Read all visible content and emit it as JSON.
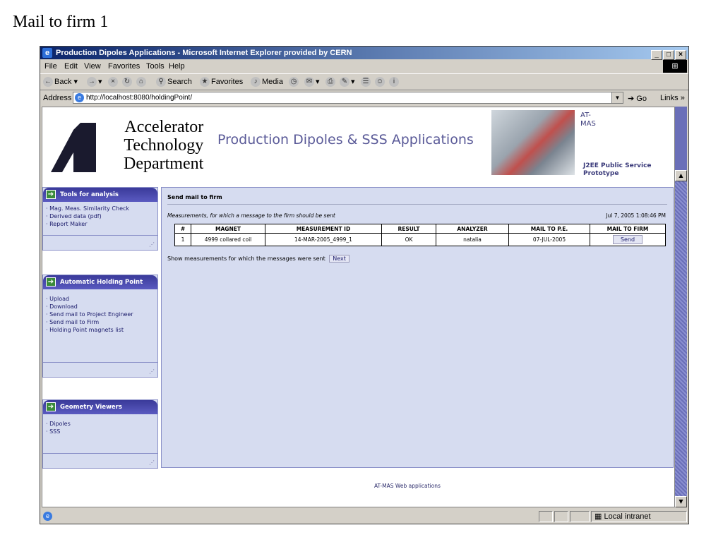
{
  "slide": {
    "title": "Mail to firm 1"
  },
  "browser": {
    "window_title": "Production Dipoles Applications - Microsoft Internet Explorer provided by CERN",
    "menu": [
      "File",
      "Edit",
      "View",
      "Favorites",
      "Tools",
      "Help"
    ],
    "toolbar": {
      "back": "Back",
      "search": "Search",
      "favorites": "Favorites",
      "media": "Media"
    },
    "address_label": "Address",
    "address_value": "http://localhost:8080/holdingPoint/",
    "go_label": "Go",
    "links_label": "Links",
    "status_zone": "Local intranet"
  },
  "page": {
    "logo_lines": [
      "Accelerator",
      "Technology",
      "Department"
    ],
    "app_title": "Production Dipoles & SSS Applications",
    "atmas_lines": [
      "AT-",
      "MAS"
    ],
    "j2ee_lines": [
      "J2EE Public Service",
      "Prototype"
    ],
    "sidebar": [
      {
        "title": "Tools for analysis",
        "items": [
          "Mag. Meas. Similarity Check",
          "Derived data (pdf)",
          "Report Maker"
        ]
      },
      {
        "title": "Automatic Holding Point",
        "items": [
          "Upload",
          "Download",
          "Send mail to Project Engineer",
          "Send mail to Firm",
          "Holding Point magnets list"
        ]
      },
      {
        "title": "Geometry Viewers",
        "items": [
          "Dipoles",
          "SSS"
        ]
      }
    ],
    "main": {
      "title": "Send mail to firm",
      "subtitle": "Measurements, for which a message to the firm should be sent",
      "date": "Jul 7, 2005 1:08:46 PM",
      "columns": [
        "#",
        "MAGNET",
        "MEASUREMENT ID",
        "RESULT",
        "ANALYZER",
        "MAIL TO P.E.",
        "MAIL TO FIRM"
      ],
      "rows": [
        {
          "num": "1",
          "magnet": "4999 collared coil",
          "measurement_id": "14-MAR-2005_4999_1",
          "result": "OK",
          "analyzer": "natalia",
          "mail_pe": "07-JUL-2005",
          "send_label": "Send"
        }
      ],
      "show_text": "Show measurements for which the messages were sent",
      "next_label": "Next"
    },
    "footer": "AT-MAS Web applications"
  }
}
